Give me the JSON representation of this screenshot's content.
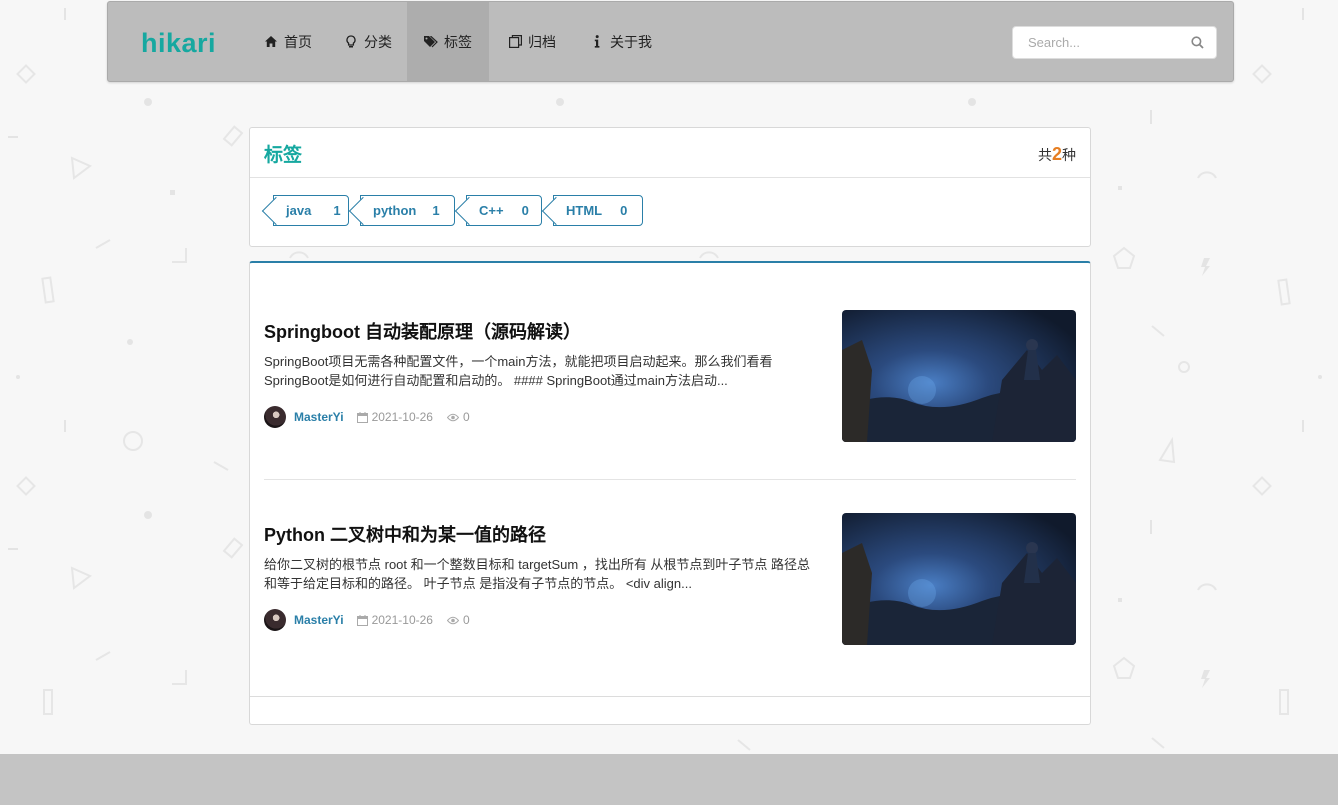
{
  "site": {
    "brand": "hikari"
  },
  "nav": {
    "items": [
      {
        "label": "首页",
        "icon": "home-icon"
      },
      {
        "label": "分类",
        "icon": "lightbulb-icon"
      },
      {
        "label": "标签",
        "icon": "tags-icon",
        "active": true
      },
      {
        "label": "归档",
        "icon": "archive-icon"
      },
      {
        "label": "关于我",
        "icon": "info-icon"
      }
    ]
  },
  "search": {
    "placeholder": "Search...",
    "icon": "search-icon"
  },
  "tags_panel": {
    "title": "标签",
    "count_prefix": "共",
    "count": "2",
    "count_suffix": "种",
    "tags": [
      {
        "name": "java",
        "count": "1"
      },
      {
        "name": "python",
        "count": "1"
      },
      {
        "name": "C++",
        "count": "0"
      },
      {
        "name": "HTML",
        "count": "0"
      }
    ]
  },
  "posts": [
    {
      "title": "Springboot 自动装配原理（源码解读）",
      "excerpt": "SpringBoot项目无需各种配置文件，一个main方法，就能把项目启动起来。那么我们看看SpringBoot是如何进行自动配置和启动的。 #### SpringBoot通过main方法启动...",
      "author": "MasterYi",
      "date": "2021-10-26",
      "views": "0"
    },
    {
      "title": "Python 二叉树中和为某一值的路径",
      "excerpt": "给你二叉树的根节点 root 和一个整数目标和 targetSum ，找出所有 从根节点到叶子节点 路径总和等于给定目标和的路径。 叶子节点 是指没有子节点的节点。 <div align...",
      "author": "MasterYi",
      "date": "2021-10-26",
      "views": "0"
    }
  ],
  "colors": {
    "accent": "#16a8a0",
    "link": "#2a7fa8",
    "count": "#e67e22",
    "navbar": "#bcbcbc"
  }
}
